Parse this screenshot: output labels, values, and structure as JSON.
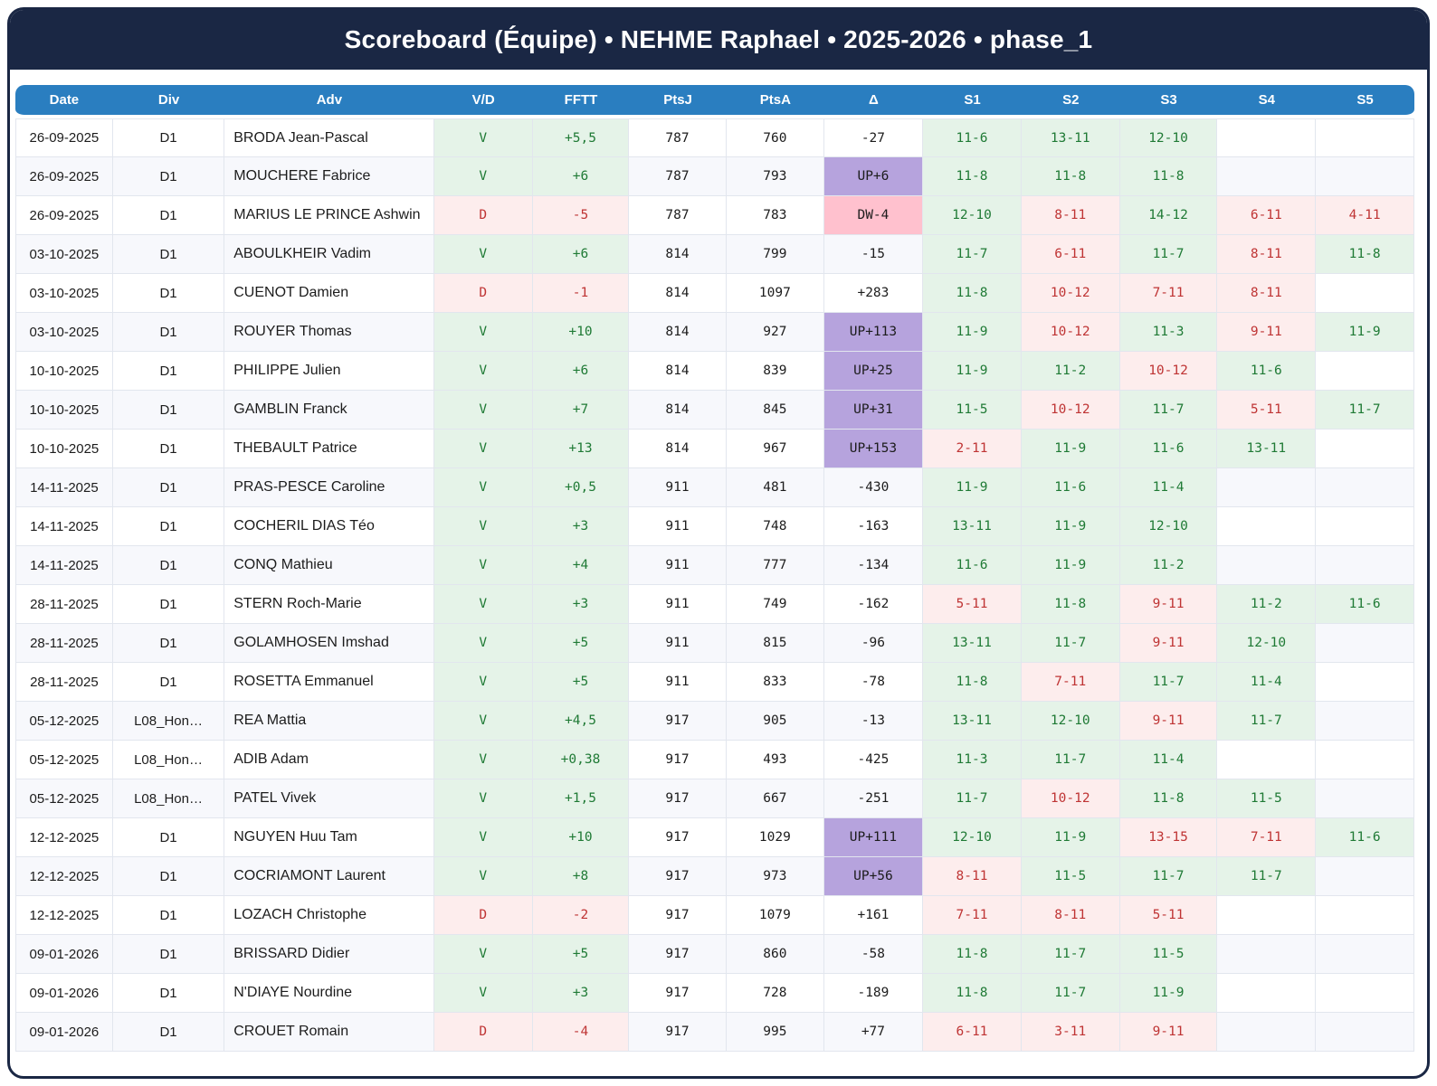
{
  "title": "Scoreboard (Équipe) • NEHME Raphael • 2025-2026 • phase_1",
  "colors": {
    "title_bar_bg": "#1a2744",
    "header_row_bg": "#2a7ec0",
    "row_alt_bg": "#f7f8fc",
    "win_text": "#1f7a35",
    "win_bg": "#e5f3e8",
    "loss_text": "#bf3434",
    "loss_bg": "#fdeded",
    "rank_up_bg": "#b6a3dd",
    "rank_down_bg": "#ffc1ce"
  },
  "table": {
    "columns": [
      "Date",
      "Div",
      "Adv",
      "V/D",
      "FFTT",
      "PtsJ",
      "PtsA",
      "Δ",
      "S1",
      "S2",
      "S3",
      "S4",
      "S5"
    ],
    "rows": [
      {
        "date": "26-09-2025",
        "div": "D1",
        "adv": "BRODA Jean-Pascal",
        "vd": "V",
        "fftt": "+5,5",
        "ptsj": "787",
        "ptsa": "760",
        "delta": "-27",
        "delta_type": "none",
        "sets": [
          {
            "score": "11-6",
            "result": "win"
          },
          {
            "score": "13-11",
            "result": "win"
          },
          {
            "score": "12-10",
            "result": "win"
          },
          null,
          null
        ]
      },
      {
        "date": "26-09-2025",
        "div": "D1",
        "adv": "MOUCHERE Fabrice",
        "vd": "V",
        "fftt": "+6",
        "ptsj": "787",
        "ptsa": "793",
        "delta": "UP+6",
        "delta_type": "up",
        "sets": [
          {
            "score": "11-8",
            "result": "win"
          },
          {
            "score": "11-8",
            "result": "win"
          },
          {
            "score": "11-8",
            "result": "win"
          },
          null,
          null
        ]
      },
      {
        "date": "26-09-2025",
        "div": "D1",
        "adv": "MARIUS LE PRINCE Ashwin",
        "vd": "D",
        "fftt": "-5",
        "ptsj": "787",
        "ptsa": "783",
        "delta": "DW-4",
        "delta_type": "down",
        "sets": [
          {
            "score": "12-10",
            "result": "win"
          },
          {
            "score": "8-11",
            "result": "loss"
          },
          {
            "score": "14-12",
            "result": "win"
          },
          {
            "score": "6-11",
            "result": "loss"
          },
          {
            "score": "4-11",
            "result": "loss"
          }
        ]
      },
      {
        "date": "03-10-2025",
        "div": "D1",
        "adv": "ABOULKHEIR Vadim",
        "vd": "V",
        "fftt": "+6",
        "ptsj": "814",
        "ptsa": "799",
        "delta": "-15",
        "delta_type": "none",
        "sets": [
          {
            "score": "11-7",
            "result": "win"
          },
          {
            "score": "6-11",
            "result": "loss"
          },
          {
            "score": "11-7",
            "result": "win"
          },
          {
            "score": "8-11",
            "result": "loss"
          },
          {
            "score": "11-8",
            "result": "win"
          }
        ]
      },
      {
        "date": "03-10-2025",
        "div": "D1",
        "adv": "CUENOT Damien",
        "vd": "D",
        "fftt": "-1",
        "ptsj": "814",
        "ptsa": "1097",
        "delta": "+283",
        "delta_type": "none",
        "sets": [
          {
            "score": "11-8",
            "result": "win"
          },
          {
            "score": "10-12",
            "result": "loss"
          },
          {
            "score": "7-11",
            "result": "loss"
          },
          {
            "score": "8-11",
            "result": "loss"
          },
          null
        ]
      },
      {
        "date": "03-10-2025",
        "div": "D1",
        "adv": "ROUYER Thomas",
        "vd": "V",
        "fftt": "+10",
        "ptsj": "814",
        "ptsa": "927",
        "delta": "UP+113",
        "delta_type": "up",
        "sets": [
          {
            "score": "11-9",
            "result": "win"
          },
          {
            "score": "10-12",
            "result": "loss"
          },
          {
            "score": "11-3",
            "result": "win"
          },
          {
            "score": "9-11",
            "result": "loss"
          },
          {
            "score": "11-9",
            "result": "win"
          }
        ]
      },
      {
        "date": "10-10-2025",
        "div": "D1",
        "adv": "PHILIPPE Julien",
        "vd": "V",
        "fftt": "+6",
        "ptsj": "814",
        "ptsa": "839",
        "delta": "UP+25",
        "delta_type": "up",
        "sets": [
          {
            "score": "11-9",
            "result": "win"
          },
          {
            "score": "11-2",
            "result": "win"
          },
          {
            "score": "10-12",
            "result": "loss"
          },
          {
            "score": "11-6",
            "result": "win"
          },
          null
        ]
      },
      {
        "date": "10-10-2025",
        "div": "D1",
        "adv": "GAMBLIN Franck",
        "vd": "V",
        "fftt": "+7",
        "ptsj": "814",
        "ptsa": "845",
        "delta": "UP+31",
        "delta_type": "up",
        "sets": [
          {
            "score": "11-5",
            "result": "win"
          },
          {
            "score": "10-12",
            "result": "loss"
          },
          {
            "score": "11-7",
            "result": "win"
          },
          {
            "score": "5-11",
            "result": "loss"
          },
          {
            "score": "11-7",
            "result": "win"
          }
        ]
      },
      {
        "date": "10-10-2025",
        "div": "D1",
        "adv": "THEBAULT Patrice",
        "vd": "V",
        "fftt": "+13",
        "ptsj": "814",
        "ptsa": "967",
        "delta": "UP+153",
        "delta_type": "up",
        "sets": [
          {
            "score": "2-11",
            "result": "loss"
          },
          {
            "score": "11-9",
            "result": "win"
          },
          {
            "score": "11-6",
            "result": "win"
          },
          {
            "score": "13-11",
            "result": "win"
          },
          null
        ]
      },
      {
        "date": "14-11-2025",
        "div": "D1",
        "adv": "PRAS-PESCE Caroline",
        "vd": "V",
        "fftt": "+0,5",
        "ptsj": "911",
        "ptsa": "481",
        "delta": "-430",
        "delta_type": "none",
        "sets": [
          {
            "score": "11-9",
            "result": "win"
          },
          {
            "score": "11-6",
            "result": "win"
          },
          {
            "score": "11-4",
            "result": "win"
          },
          null,
          null
        ]
      },
      {
        "date": "14-11-2025",
        "div": "D1",
        "adv": "COCHERIL DIAS Téo",
        "vd": "V",
        "fftt": "+3",
        "ptsj": "911",
        "ptsa": "748",
        "delta": "-163",
        "delta_type": "none",
        "sets": [
          {
            "score": "13-11",
            "result": "win"
          },
          {
            "score": "11-9",
            "result": "win"
          },
          {
            "score": "12-10",
            "result": "win"
          },
          null,
          null
        ]
      },
      {
        "date": "14-11-2025",
        "div": "D1",
        "adv": "CONQ Mathieu",
        "vd": "V",
        "fftt": "+4",
        "ptsj": "911",
        "ptsa": "777",
        "delta": "-134",
        "delta_type": "none",
        "sets": [
          {
            "score": "11-6",
            "result": "win"
          },
          {
            "score": "11-9",
            "result": "win"
          },
          {
            "score": "11-2",
            "result": "win"
          },
          null,
          null
        ]
      },
      {
        "date": "28-11-2025",
        "div": "D1",
        "adv": "STERN Roch-Marie",
        "vd": "V",
        "fftt": "+3",
        "ptsj": "911",
        "ptsa": "749",
        "delta": "-162",
        "delta_type": "none",
        "sets": [
          {
            "score": "5-11",
            "result": "loss"
          },
          {
            "score": "11-8",
            "result": "win"
          },
          {
            "score": "9-11",
            "result": "loss"
          },
          {
            "score": "11-2",
            "result": "win"
          },
          {
            "score": "11-6",
            "result": "win"
          }
        ]
      },
      {
        "date": "28-11-2025",
        "div": "D1",
        "adv": "GOLAMHOSEN Imshad",
        "vd": "V",
        "fftt": "+5",
        "ptsj": "911",
        "ptsa": "815",
        "delta": "-96",
        "delta_type": "none",
        "sets": [
          {
            "score": "13-11",
            "result": "win"
          },
          {
            "score": "11-7",
            "result": "win"
          },
          {
            "score": "9-11",
            "result": "loss"
          },
          {
            "score": "12-10",
            "result": "win"
          },
          null
        ]
      },
      {
        "date": "28-11-2025",
        "div": "D1",
        "adv": "ROSETTA Emmanuel",
        "vd": "V",
        "fftt": "+5",
        "ptsj": "911",
        "ptsa": "833",
        "delta": "-78",
        "delta_type": "none",
        "sets": [
          {
            "score": "11-8",
            "result": "win"
          },
          {
            "score": "7-11",
            "result": "loss"
          },
          {
            "score": "11-7",
            "result": "win"
          },
          {
            "score": "11-4",
            "result": "win"
          },
          null
        ]
      },
      {
        "date": "05-12-2025",
        "div": "L08_Hon…",
        "adv": "REA Mattia",
        "vd": "V",
        "fftt": "+4,5",
        "ptsj": "917",
        "ptsa": "905",
        "delta": "-13",
        "delta_type": "none",
        "sets": [
          {
            "score": "13-11",
            "result": "win"
          },
          {
            "score": "12-10",
            "result": "win"
          },
          {
            "score": "9-11",
            "result": "loss"
          },
          {
            "score": "11-7",
            "result": "win"
          },
          null
        ]
      },
      {
        "date": "05-12-2025",
        "div": "L08_Hon…",
        "adv": "ADIB Adam",
        "vd": "V",
        "fftt": "+0,38",
        "ptsj": "917",
        "ptsa": "493",
        "delta": "-425",
        "delta_type": "none",
        "sets": [
          {
            "score": "11-3",
            "result": "win"
          },
          {
            "score": "11-7",
            "result": "win"
          },
          {
            "score": "11-4",
            "result": "win"
          },
          null,
          null
        ]
      },
      {
        "date": "05-12-2025",
        "div": "L08_Hon…",
        "adv": "PATEL Vivek",
        "vd": "V",
        "fftt": "+1,5",
        "ptsj": "917",
        "ptsa": "667",
        "delta": "-251",
        "delta_type": "none",
        "sets": [
          {
            "score": "11-7",
            "result": "win"
          },
          {
            "score": "10-12",
            "result": "loss"
          },
          {
            "score": "11-8",
            "result": "win"
          },
          {
            "score": "11-5",
            "result": "win"
          },
          null
        ]
      },
      {
        "date": "12-12-2025",
        "div": "D1",
        "adv": "NGUYEN Huu Tam",
        "vd": "V",
        "fftt": "+10",
        "ptsj": "917",
        "ptsa": "1029",
        "delta": "UP+111",
        "delta_type": "up",
        "sets": [
          {
            "score": "12-10",
            "result": "win"
          },
          {
            "score": "11-9",
            "result": "win"
          },
          {
            "score": "13-15",
            "result": "loss"
          },
          {
            "score": "7-11",
            "result": "loss"
          },
          {
            "score": "11-6",
            "result": "win"
          }
        ]
      },
      {
        "date": "12-12-2025",
        "div": "D1",
        "adv": "COCRIAMONT Laurent",
        "vd": "V",
        "fftt": "+8",
        "ptsj": "917",
        "ptsa": "973",
        "delta": "UP+56",
        "delta_type": "up",
        "sets": [
          {
            "score": "8-11",
            "result": "loss"
          },
          {
            "score": "11-5",
            "result": "win"
          },
          {
            "score": "11-7",
            "result": "win"
          },
          {
            "score": "11-7",
            "result": "win"
          },
          null
        ]
      },
      {
        "date": "12-12-2025",
        "div": "D1",
        "adv": "LOZACH Christophe",
        "vd": "D",
        "fftt": "-2",
        "ptsj": "917",
        "ptsa": "1079",
        "delta": "+161",
        "delta_type": "none",
        "sets": [
          {
            "score": "7-11",
            "result": "loss"
          },
          {
            "score": "8-11",
            "result": "loss"
          },
          {
            "score": "5-11",
            "result": "loss"
          },
          null,
          null
        ]
      },
      {
        "date": "09-01-2026",
        "div": "D1",
        "adv": "BRISSARD Didier",
        "vd": "V",
        "fftt": "+5",
        "ptsj": "917",
        "ptsa": "860",
        "delta": "-58",
        "delta_type": "none",
        "sets": [
          {
            "score": "11-8",
            "result": "win"
          },
          {
            "score": "11-7",
            "result": "win"
          },
          {
            "score": "11-5",
            "result": "win"
          },
          null,
          null
        ]
      },
      {
        "date": "09-01-2026",
        "div": "D1",
        "adv": "N'DIAYE Nourdine",
        "vd": "V",
        "fftt": "+3",
        "ptsj": "917",
        "ptsa": "728",
        "delta": "-189",
        "delta_type": "none",
        "sets": [
          {
            "score": "11-8",
            "result": "win"
          },
          {
            "score": "11-7",
            "result": "win"
          },
          {
            "score": "11-9",
            "result": "win"
          },
          null,
          null
        ]
      },
      {
        "date": "09-01-2026",
        "div": "D1",
        "adv": "CROUET Romain",
        "vd": "D",
        "fftt": "-4",
        "ptsj": "917",
        "ptsa": "995",
        "delta": "+77",
        "delta_type": "none",
        "sets": [
          {
            "score": "6-11",
            "result": "loss"
          },
          {
            "score": "3-11",
            "result": "loss"
          },
          {
            "score": "9-11",
            "result": "loss"
          },
          null,
          null
        ]
      }
    ]
  }
}
